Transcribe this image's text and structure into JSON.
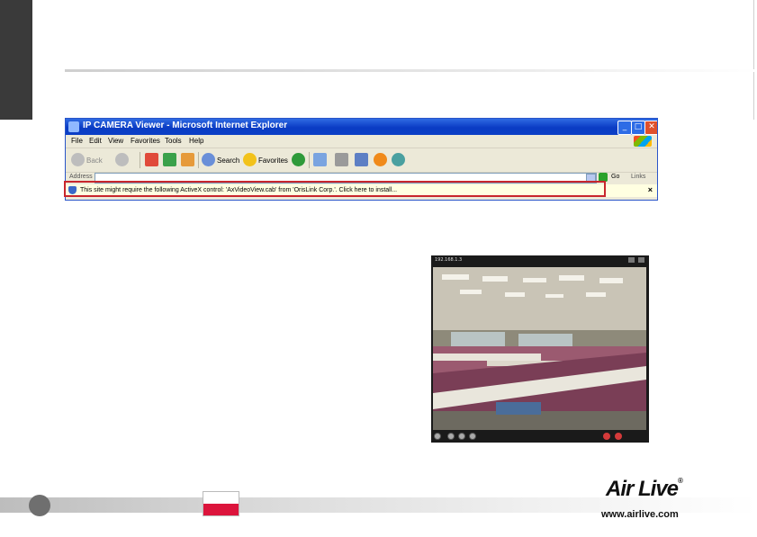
{
  "ie_window": {
    "title": "IP CAMERA Viewer - Microsoft Internet Explorer",
    "menu": [
      "File",
      "Edit",
      "View",
      "Favorites",
      "Tools",
      "Help"
    ],
    "toolbar": {
      "back_label": "Back",
      "search_label": "Search",
      "favorites_label": "Favorites"
    },
    "address_label": "Address",
    "go_label": "Go",
    "links_label": "Links",
    "infobar_message": "This site might require the following ActiveX control: 'AxVideoView.cab' from 'OrisLink Corp.'. Click here to install...",
    "infobar_close": "×"
  },
  "camera": {
    "ip_label": "192.168.1.3"
  },
  "footer": {
    "logo_text": "Air Live",
    "logo_mark": "®",
    "url": "www.airlive.com"
  },
  "colors": {
    "highlight_border": "#c8262c",
    "titlebar_blue": "#0a3cc4",
    "flag_red": "#dc143c",
    "infobar_bg": "#ffffe1"
  }
}
